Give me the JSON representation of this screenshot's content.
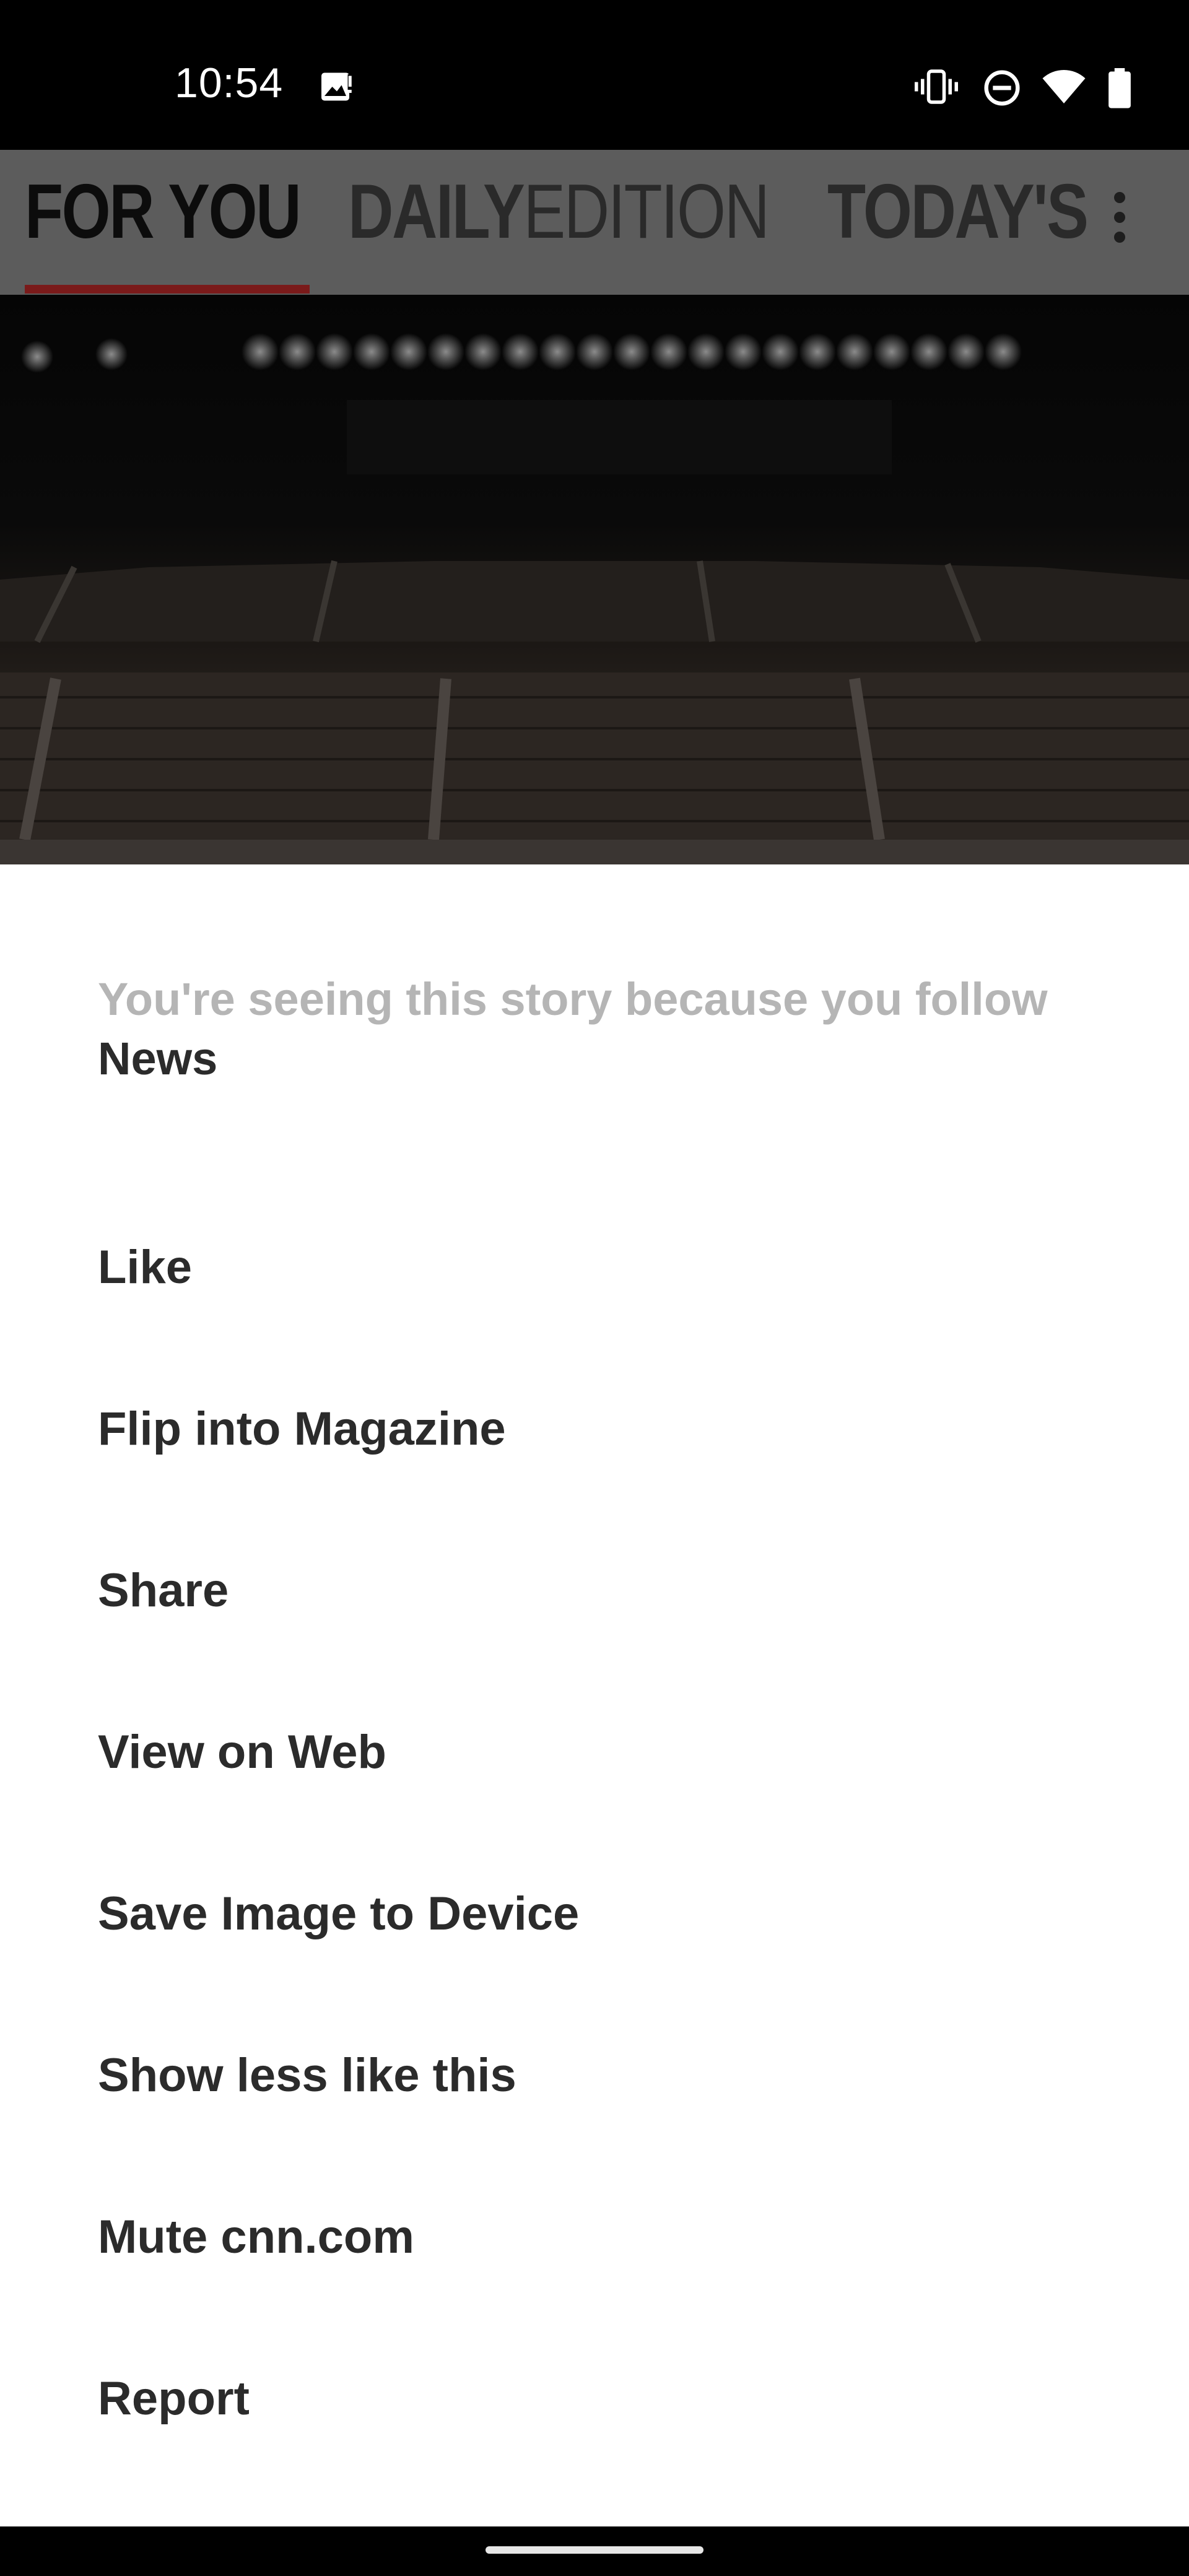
{
  "status_bar": {
    "time": "10:54",
    "icons": [
      "image-alert-icon",
      "vibrate-icon",
      "do-not-disturb-icon",
      "wifi-icon",
      "battery-icon"
    ]
  },
  "tabs": [
    {
      "label": "FOR YOU",
      "active": true
    },
    {
      "label_bold": "DAILY",
      "label_light": "EDITION",
      "active": false
    },
    {
      "label": "TODAY'S",
      "active": false
    }
  ],
  "colors": {
    "tab_indicator": "#c8302c",
    "sheet_background": "#ffffff",
    "menu_text": "#2b2b2b",
    "reason_text": "#b5b5b5"
  },
  "sheet": {
    "reason_prefix": "You're seeing this story because you follow",
    "reason_topic": "News",
    "menu_items": [
      "Like",
      "Flip into Magazine",
      "Share",
      "View on Web",
      "Save Image to Device",
      "Show less like this",
      "Mute cnn.com",
      "Report"
    ]
  }
}
